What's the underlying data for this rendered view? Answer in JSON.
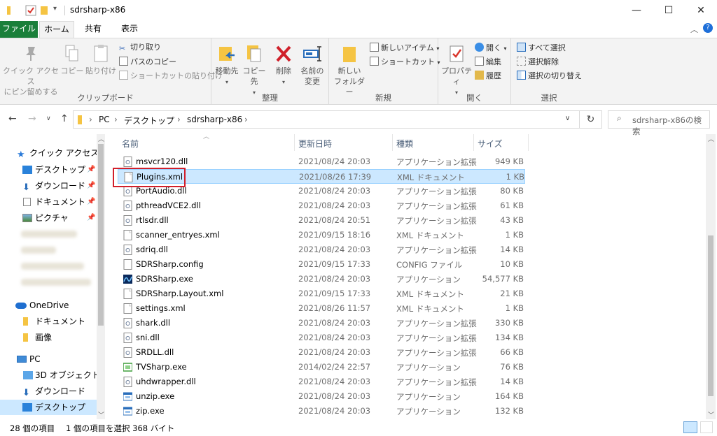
{
  "window": {
    "title": "sdrsharp-x86",
    "minimize": "—",
    "maximize": "☐",
    "close": "✕"
  },
  "tabs": [
    {
      "label": "ファイル"
    },
    {
      "label": "ホーム"
    },
    {
      "label": "共有"
    },
    {
      "label": "表示"
    }
  ],
  "ribbon": {
    "clipboard": {
      "label": "クリップボード",
      "pin_line1": "クイック アクセス",
      "pin_line2": "にピン留めする",
      "copy": "コピー",
      "paste": "貼り付け",
      "cut": "切り取り",
      "copy_path": "パスのコピー",
      "paste_shortcut": "ショートカットの貼り付け"
    },
    "organize": {
      "label": "整理",
      "move_to": "移動先",
      "copy_to": "コピー先",
      "delete": "削除",
      "rename_line1": "名前の",
      "rename_line2": "変更"
    },
    "new": {
      "label": "新規",
      "new_folder_line1": "新しい",
      "new_folder_line2": "フォルダー",
      "new_item": "新しいアイテム",
      "shortcut": "ショートカット"
    },
    "open": {
      "label": "開く",
      "properties": "プロパティ",
      "open": "開く",
      "edit": "編集",
      "history": "履歴"
    },
    "select": {
      "label": "選択",
      "select_all": "すべて選択",
      "select_none": "選択解除",
      "invert": "選択の切り替え"
    }
  },
  "address": {
    "breadcrumbs": [
      "PC",
      "デスクトップ",
      "sdrsharp-x86"
    ],
    "search_placeholder": "sdrsharp-x86の検索"
  },
  "nav_pane": {
    "quick_access": "クイック アクセス",
    "quick_items": [
      {
        "label": "デスクトップ"
      },
      {
        "label": "ダウンロード"
      },
      {
        "label": "ドキュメント"
      },
      {
        "label": "ピクチャ"
      }
    ],
    "onedrive": "OneDrive",
    "onedrive_items": [
      {
        "label": "ドキュメント"
      },
      {
        "label": "画像"
      }
    ],
    "pc": "PC",
    "pc_items": [
      {
        "label": "3D オブジェクト"
      },
      {
        "label": "ダウンロード"
      },
      {
        "label": "デスクトップ"
      }
    ]
  },
  "columns": {
    "name": "名前",
    "date": "更新日時",
    "type": "種類",
    "size": "サイズ"
  },
  "files": [
    {
      "name": "msvcr120.dll",
      "date": "2021/08/24 20:03",
      "type": "アプリケーション拡張",
      "size": "949 KB",
      "icon": "dll-icon"
    },
    {
      "name": "Plugins.xml",
      "date": "2021/08/26 17:39",
      "type": "XML ドキュメント",
      "size": "1 KB",
      "icon": "xml-file-icon"
    },
    {
      "name": "PortAudio.dll",
      "date": "2021/08/24 20:03",
      "type": "アプリケーション拡張",
      "size": "80 KB",
      "icon": "dll-icon"
    },
    {
      "name": "pthreadVCE2.dll",
      "date": "2021/08/24 20:03",
      "type": "アプリケーション拡張",
      "size": "61 KB",
      "icon": "dll-icon"
    },
    {
      "name": "rtlsdr.dll",
      "date": "2021/08/24 20:51",
      "type": "アプリケーション拡張",
      "size": "43 KB",
      "icon": "dll-icon"
    },
    {
      "name": "scanner_entryes.xml",
      "date": "2021/09/15 18:16",
      "type": "XML ドキュメント",
      "size": "1 KB",
      "icon": "xml-file-icon"
    },
    {
      "name": "sdriq.dll",
      "date": "2021/08/24 20:03",
      "type": "アプリケーション拡張",
      "size": "14 KB",
      "icon": "dll-icon"
    },
    {
      "name": "SDRSharp.config",
      "date": "2021/09/15 17:33",
      "type": "CONFIG ファイル",
      "size": "10 KB",
      "icon": "config-file-icon"
    },
    {
      "name": "SDRSharp.exe",
      "date": "2021/08/24 20:03",
      "type": "アプリケーション",
      "size": "54,577 KB",
      "icon": "sdrsharp-app-icon"
    },
    {
      "name": "SDRSharp.Layout.xml",
      "date": "2021/09/15 17:33",
      "type": "XML ドキュメント",
      "size": "21 KB",
      "icon": "xml-file-icon"
    },
    {
      "name": "settings.xml",
      "date": "2021/08/26 11:57",
      "type": "XML ドキュメント",
      "size": "1 KB",
      "icon": "xml-file-icon"
    },
    {
      "name": "shark.dll",
      "date": "2021/08/24 20:03",
      "type": "アプリケーション拡張",
      "size": "330 KB",
      "icon": "dll-icon"
    },
    {
      "name": "sni.dll",
      "date": "2021/08/24 20:03",
      "type": "アプリケーション拡張",
      "size": "134 KB",
      "icon": "dll-icon"
    },
    {
      "name": "SRDLL.dll",
      "date": "2021/08/24 20:03",
      "type": "アプリケーション拡張",
      "size": "66 KB",
      "icon": "dll-icon"
    },
    {
      "name": "TVSharp.exe",
      "date": "2014/02/24 22:57",
      "type": "アプリケーション",
      "size": "76 KB",
      "icon": "tvsharp-app-icon"
    },
    {
      "name": "uhdwrapper.dll",
      "date": "2021/08/24 20:03",
      "type": "アプリケーション拡張",
      "size": "14 KB",
      "icon": "dll-icon"
    },
    {
      "name": "unzip.exe",
      "date": "2021/08/24 20:03",
      "type": "アプリケーション",
      "size": "164 KB",
      "icon": "exe-icon"
    },
    {
      "name": "zip.exe",
      "date": "2021/08/24 20:03",
      "type": "アプリケーション",
      "size": "132 KB",
      "icon": "exe-icon"
    }
  ],
  "status": {
    "item_count": "28 個の項目",
    "selection": "1 個の項目を選択  368 バイト"
  },
  "colors": {
    "file_tab": "#1a7f3a",
    "selection": "#cce8ff",
    "highlight_box": "#d21f2b"
  }
}
